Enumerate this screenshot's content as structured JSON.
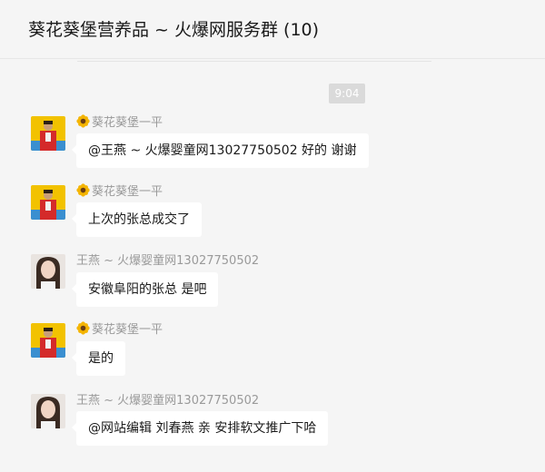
{
  "header": {
    "title": "葵花葵堡营养品 ~ 火爆网服务群 (10)"
  },
  "time_divider": "9:04",
  "messages": [
    {
      "sender": "葵花葵堡一平",
      "avatar": "man-red-jacket",
      "sender_icon": "sunflower-icon",
      "text": "@王燕 ~ 火爆婴童网13027750502 好的 谢谢"
    },
    {
      "sender": "葵花葵堡一平",
      "avatar": "man-red-jacket",
      "sender_icon": "sunflower-icon",
      "text": "上次的张总成交了"
    },
    {
      "sender": "王燕 ~ 火爆婴童网13027750502",
      "avatar": "woman-portrait",
      "text": "安徽阜阳的张总 是吧"
    },
    {
      "sender": "葵花葵堡一平",
      "avatar": "man-red-jacket",
      "sender_icon": "sunflower-icon",
      "text": "是的"
    },
    {
      "sender": "王燕 ~ 火爆婴童网13027750502",
      "avatar": "woman-portrait",
      "text": "@网站编辑 刘春燕 亲 安排软文推广下哈"
    }
  ],
  "colors": {
    "background": "#f5f5f5",
    "bubble": "#ffffff",
    "sender_name": "#9a9a9a",
    "time_badge": "#dadada"
  }
}
